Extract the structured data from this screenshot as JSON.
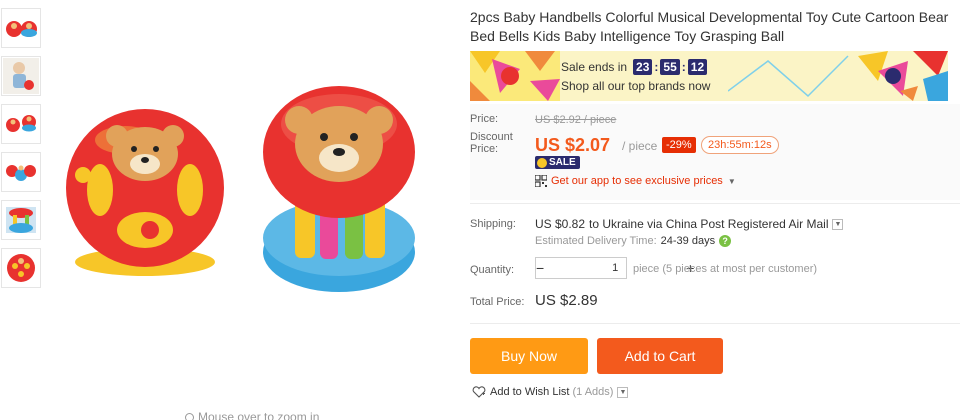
{
  "product": {
    "title": "2pcs Baby Handbells Colorful Musical Developmental Toy Cute Cartoon Bear Bed Bells Kids Baby Intelligence Toy Grasping Ball"
  },
  "gallery": {
    "thumbnail_count": 6,
    "zoom_hint": "Mouse over to zoom in"
  },
  "banner": {
    "sale_ends_label": "Sale ends in",
    "hours": "23",
    "minutes": "55",
    "seconds": "12",
    "shop_all": "Shop all our top brands now"
  },
  "pricing": {
    "price_label": "Price:",
    "original_price": "US $2.92 / piece",
    "discount_label_line1": "Discount",
    "discount_label_line2": "Price:",
    "discount_price": "US $2.07",
    "per_piece": "/ piece",
    "discount_pct": "-29%",
    "countdown": "23h:55m:12s",
    "sale_badge": "SALE",
    "app_promo": "Get our app to see exclusive prices"
  },
  "shipping": {
    "label": "Shipping:",
    "cost": "US $0.82",
    "description": "to Ukraine via China Post Registered Air Mail",
    "estimated_label": "Estimated Delivery Time:",
    "estimated_days": "24-39 days"
  },
  "quantity": {
    "label": "Quantity:",
    "value": "1",
    "note": "piece (5 pieces at most per customer)",
    "minus": "−",
    "plus": "+"
  },
  "total": {
    "label": "Total Price:",
    "value": "US $2.89"
  },
  "actions": {
    "buy_now": "Buy Now",
    "add_to_cart": "Add to Cart",
    "wishlist": "Add to Wish List",
    "wishlist_adds": "(1 Adds)"
  },
  "colors": {
    "accent_orange": "#ff9a14",
    "cart_orange": "#f35a1d",
    "price_red": "#f35a1d",
    "sale_navy": "#2b2b6e"
  }
}
